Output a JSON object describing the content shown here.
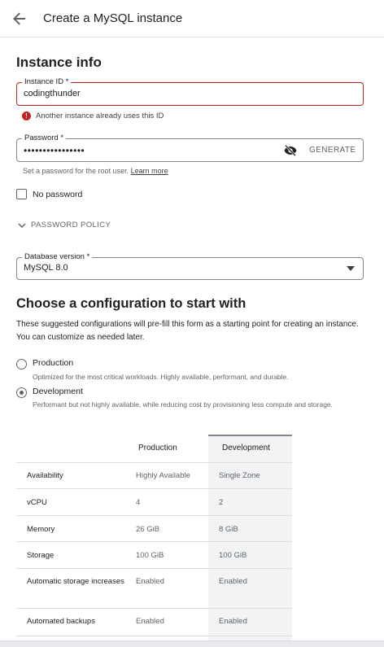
{
  "header": {
    "title": "Create a MySQL instance",
    "back_icon": "arrow-back-icon"
  },
  "instance_info": {
    "section_title": "Instance info",
    "instance_id": {
      "label": "Instance ID *",
      "value": "codingthunder",
      "error": "Another instance already uses this ID"
    },
    "password": {
      "label": "Password *",
      "value": "••••••••••••••••",
      "generate_label": "GENERATE",
      "helper": "Set a password for the root user.",
      "learn_more": "Learn more"
    },
    "no_password_label": "No password",
    "password_policy_label": "PASSWORD POLICY",
    "database_version": {
      "label": "Database version *",
      "value": "MySQL 8.0"
    }
  },
  "configuration": {
    "section_title": "Choose a configuration to start with",
    "description": "These suggested configurations will pre-fill this form as a starting point for creating an instance. You can customize as needed later.",
    "options": [
      {
        "label": "Production",
        "desc": "Optimized for the most critical workloads. Highly available, performant, and durable.",
        "selected": false
      },
      {
        "label": "Development",
        "desc": "Performant but not highly available, while reducing cost by provisioning less compute and storage.",
        "selected": true
      }
    ],
    "table": {
      "headers": [
        "",
        "Production",
        "Development"
      ],
      "rows": [
        [
          "Availability",
          "Highly Available",
          "Single Zone"
        ],
        [
          "vCPU",
          "4",
          "2"
        ],
        [
          "Memory",
          "26 GiB",
          "8 GiB"
        ],
        [
          "Storage",
          "100 GiB",
          "100 GiB"
        ],
        [
          "Automatic storage increases",
          "Enabled",
          "Enabled"
        ],
        [
          "Automated backups",
          "Enabled",
          "Enabled"
        ]
      ]
    }
  },
  "colors": {
    "error": "#c5221f",
    "text": "#202124",
    "secondary": "#5f6368",
    "selected_column_bg": "#f1f3f4"
  }
}
